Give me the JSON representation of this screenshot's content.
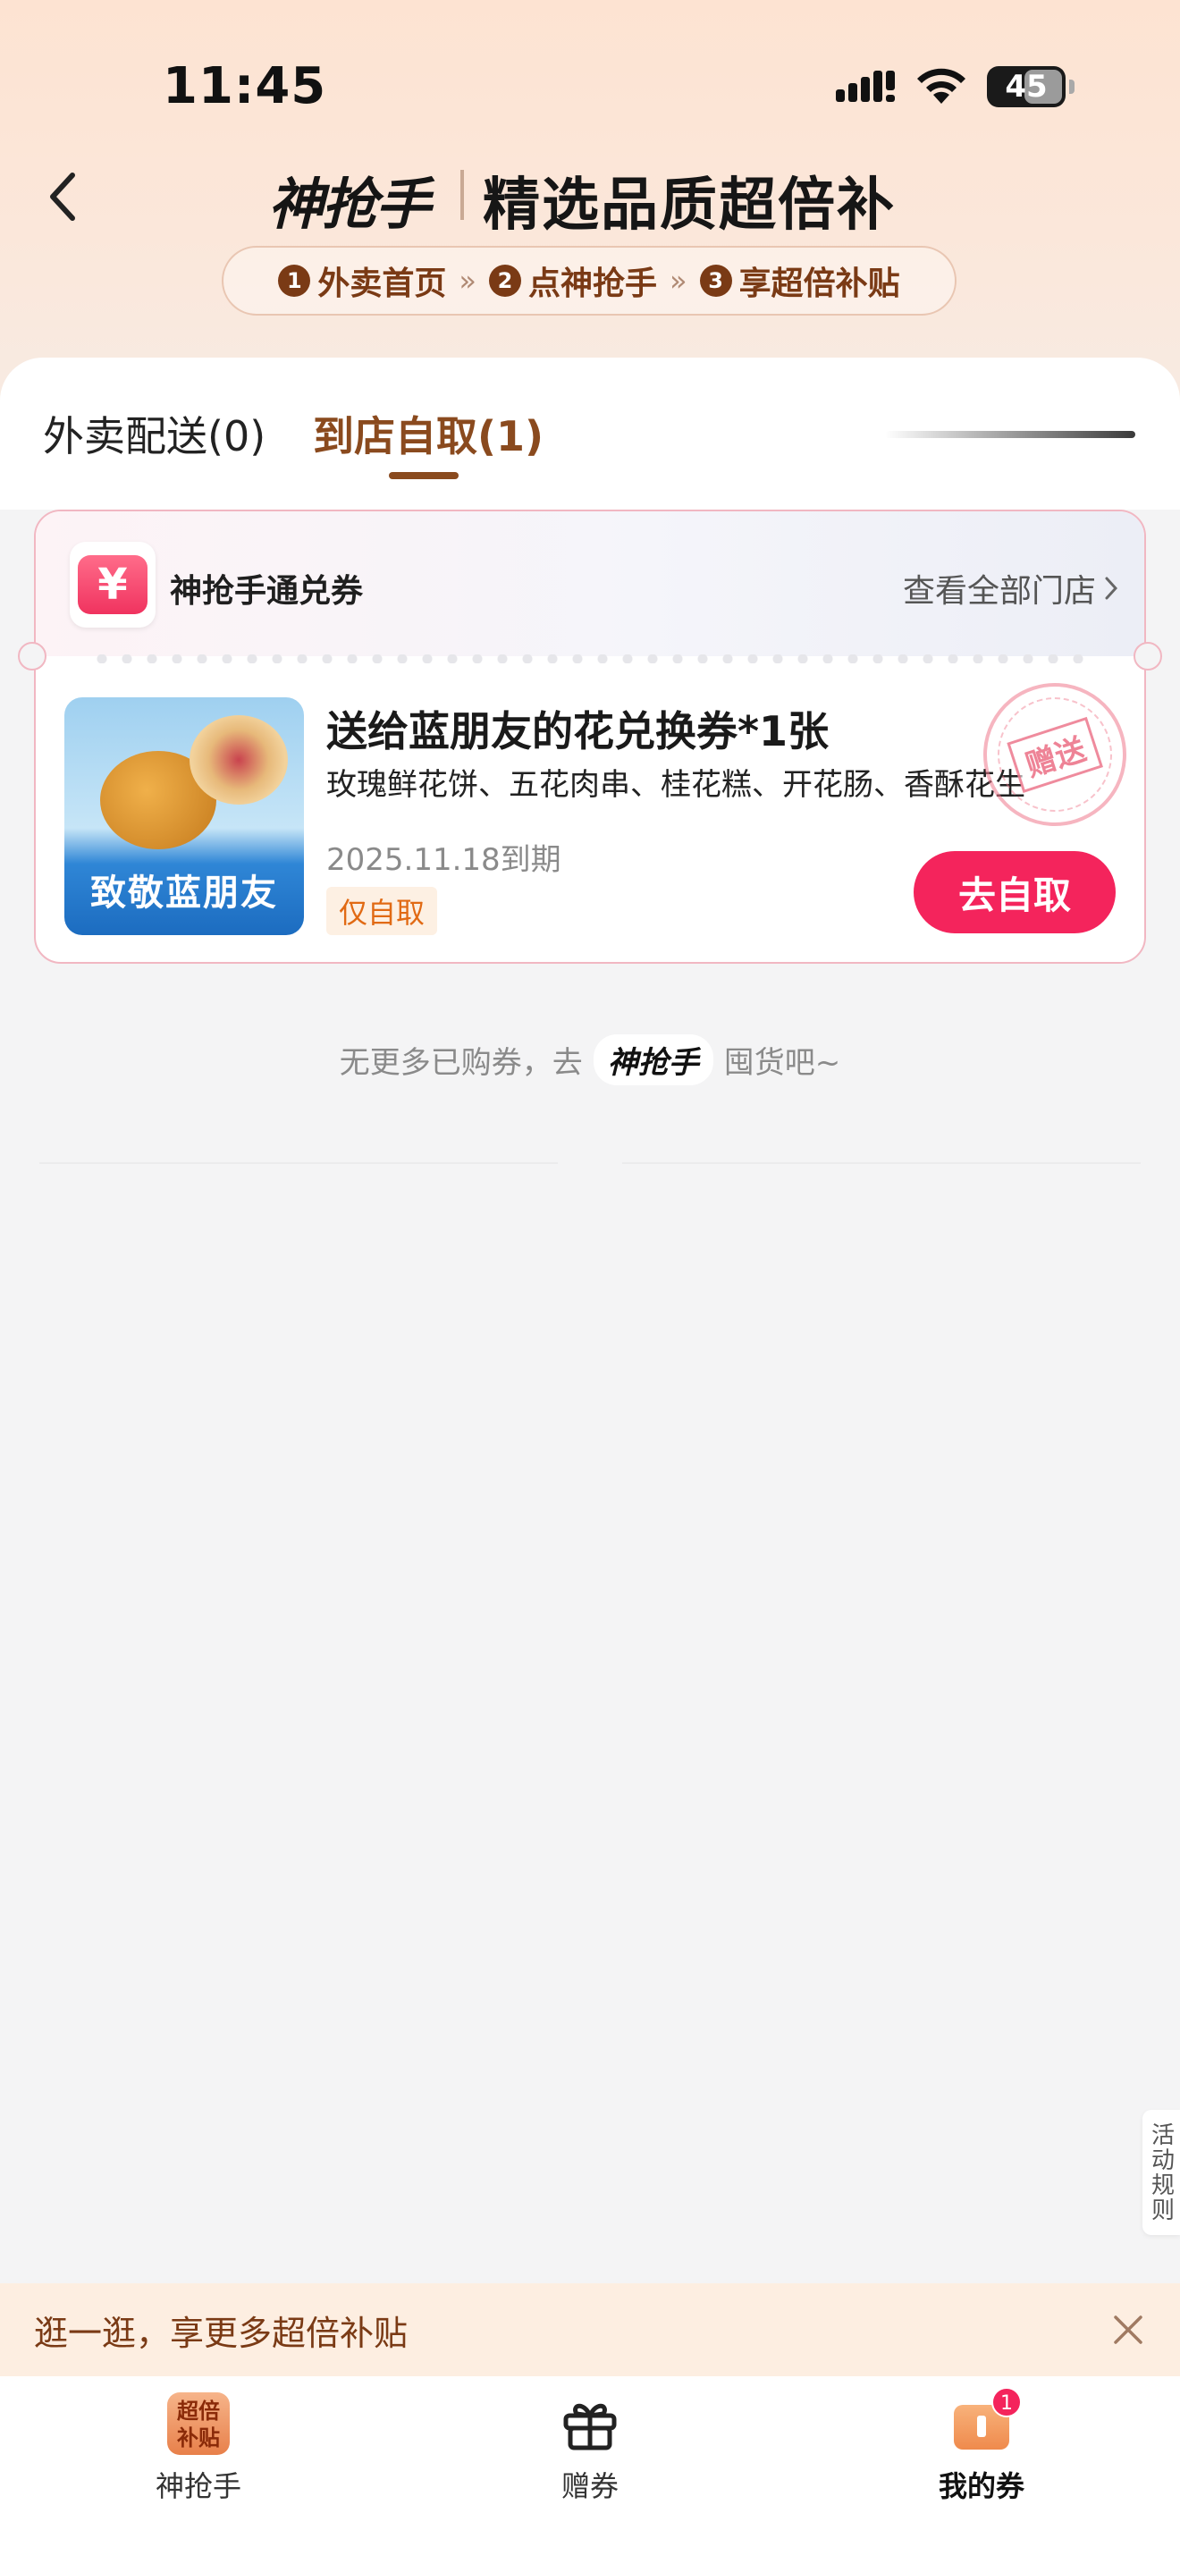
{
  "status_bar": {
    "time": "11:45",
    "battery": "45"
  },
  "header": {
    "brand": "神抢手",
    "title": "精选品质超倍补",
    "steps": [
      {
        "num": "1",
        "label": "外卖首页"
      },
      {
        "num": "2",
        "label": "点神抢手"
      },
      {
        "num": "3",
        "label": "享超倍补贴"
      }
    ],
    "step_separator": "»"
  },
  "tabs": {
    "delivery": "外卖配送(0)",
    "pickup": "到店自取(1)"
  },
  "voucher": {
    "type_icon_glyph": "¥",
    "type_label": "神抢手通兑券",
    "view_all_stores": "查看全部门店",
    "thumb_banner": "致敬蓝朋友",
    "name": "送给蓝朋友的花兑换券*1张",
    "items": "玫瑰鲜花饼、五花肉串、桂花糕、开花肠、香酥花生",
    "expiry": "2025.11.18到期",
    "tag": "仅自取",
    "stamp": "赠送",
    "action": "去自取"
  },
  "footer_note": {
    "prefix": "无更多已购券，去",
    "logo": "神抢手",
    "suffix": "囤货吧~"
  },
  "activity_rules": "活动规则",
  "promo_banner": {
    "text": "逛一逛，享更多超倍补贴"
  },
  "bottom_nav": {
    "items": [
      {
        "label": "神抢手",
        "tile": "超倍补贴",
        "icon": "subsidy-tile-icon"
      },
      {
        "label": "赠券",
        "icon": "gift-icon"
      },
      {
        "label": "我的券",
        "icon": "ticket-icon",
        "badge": "1"
      }
    ]
  },
  "colors": {
    "accent": "#8a4a1e",
    "primary_button": "#f4245c",
    "card_border": "#f1b7c2"
  }
}
